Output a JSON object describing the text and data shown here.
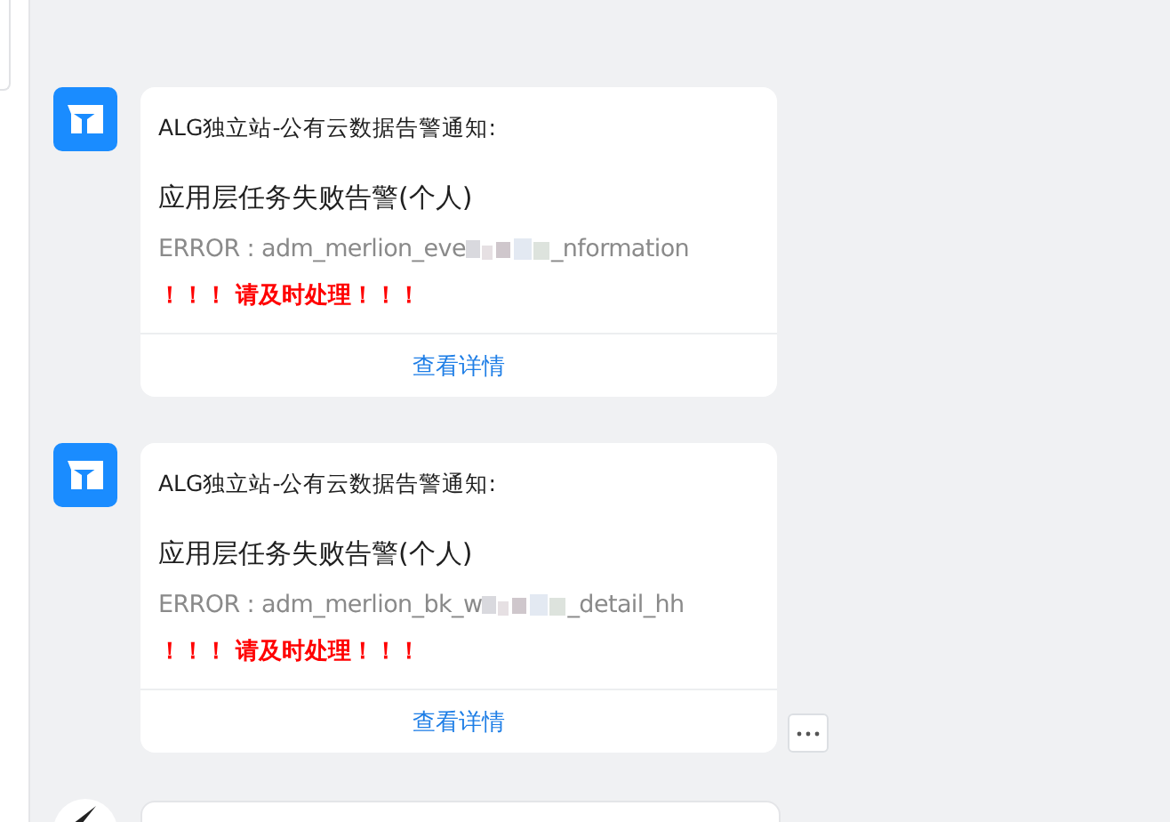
{
  "messages": [
    {
      "title": "ALG独立站-公有云数据告警通知:",
      "heading": "应用层任务失败告警(个人)",
      "error_start": "ERROR : adm_merlion_eve",
      "error_end": "_nformation",
      "warning": "！！！ 请及时处理！！！",
      "link": "查看详情",
      "more_button": false
    },
    {
      "title": "ALG独立站-公有云数据告警通知:",
      "heading": "应用层任务失败告警(个人)",
      "error_start": "ERROR : adm_merlion_bk_w",
      "error_end": "_detail_hh",
      "warning": "！！！ 请及时处理！！！",
      "link": "查看详情",
      "more_button": true
    }
  ]
}
